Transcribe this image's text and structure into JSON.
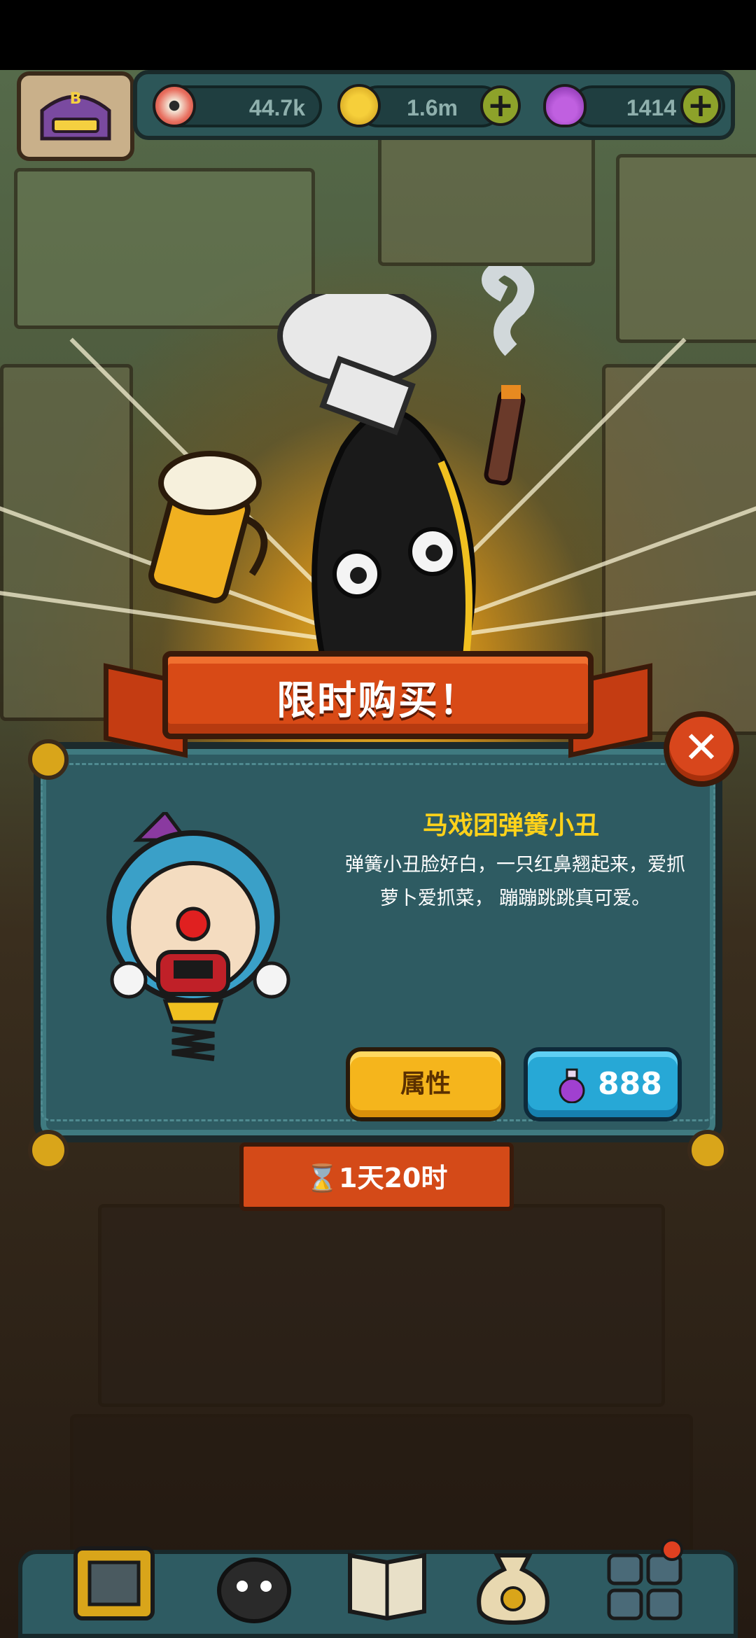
{
  "resources": {
    "eyes": "44.7k",
    "coins": "1.6m",
    "potions": "1414"
  },
  "dialog": {
    "title": "限时购买！",
    "item_name": "马戏团弹簧小丑",
    "description": "弹簧小丑脸好白，一只红鼻翘起来，爱抓萝卜爱抓菜， 蹦蹦跳跳真可爱。",
    "attributes_label": "属性",
    "price": "888",
    "timer": "1天20时"
  },
  "colors": {
    "dialog_bg": "#2e5b62",
    "banner_red": "#d84a16",
    "item_name": "#ffd21a",
    "attr_button": "#f5b51c",
    "buy_button": "#27a8d6"
  },
  "icons": {
    "eye": "eye-icon",
    "coin": "coin-icon",
    "potion": "potion-icon",
    "hourglass": "hourglass-icon",
    "close": "close-icon"
  }
}
